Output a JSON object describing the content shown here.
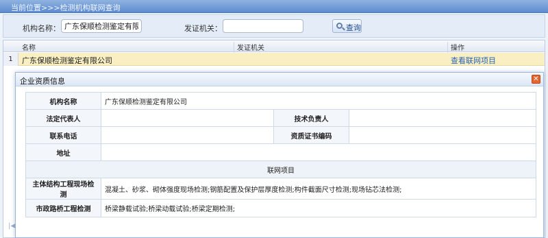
{
  "breadcrumb": "当前位置>>>检测机构联网查询",
  "search": {
    "org_name_label": "机构名称：",
    "org_name_value": "广东保顺检测鉴定有限公司",
    "issuer_label": "发证机关：",
    "issuer_value": "",
    "search_button": "查询"
  },
  "grid": {
    "columns": [
      "名称",
      "发证机关",
      "操作"
    ],
    "rows": [
      {
        "index": "1",
        "name": "广东保顺检测鉴定有限公司",
        "issuer": "",
        "action": "查看联网项目"
      }
    ],
    "pager_icon": "|◀"
  },
  "dialog": {
    "title": "企业资质信息",
    "close_icon": "✕",
    "fields": {
      "org_name_label": "机构名称",
      "org_name_value": "广东保顺检测鉴定有限公司",
      "legal_rep_label": "法定代表人",
      "legal_rep_value": "",
      "tech_lead_label": "技术负责人",
      "tech_lead_value": "",
      "phone_label": "联系电话",
      "phone_value": "",
      "cert_no_label": "资质证书编码",
      "cert_no_value": "",
      "address_label": "地址",
      "address_value": ""
    },
    "section_title": "联网项目",
    "projects": [
      {
        "label": "主体结构工程现场检测",
        "value": "混凝土、砂浆、砌体强度现场检测;钢筋配置及保护层厚度检测;构件截面尺寸检测;现场钻芯法检测;"
      },
      {
        "label": "市政路桥工程检测",
        "value": "桥梁静载试验;桥梁动载试验;桥梁定期检测;"
      }
    ]
  }
}
